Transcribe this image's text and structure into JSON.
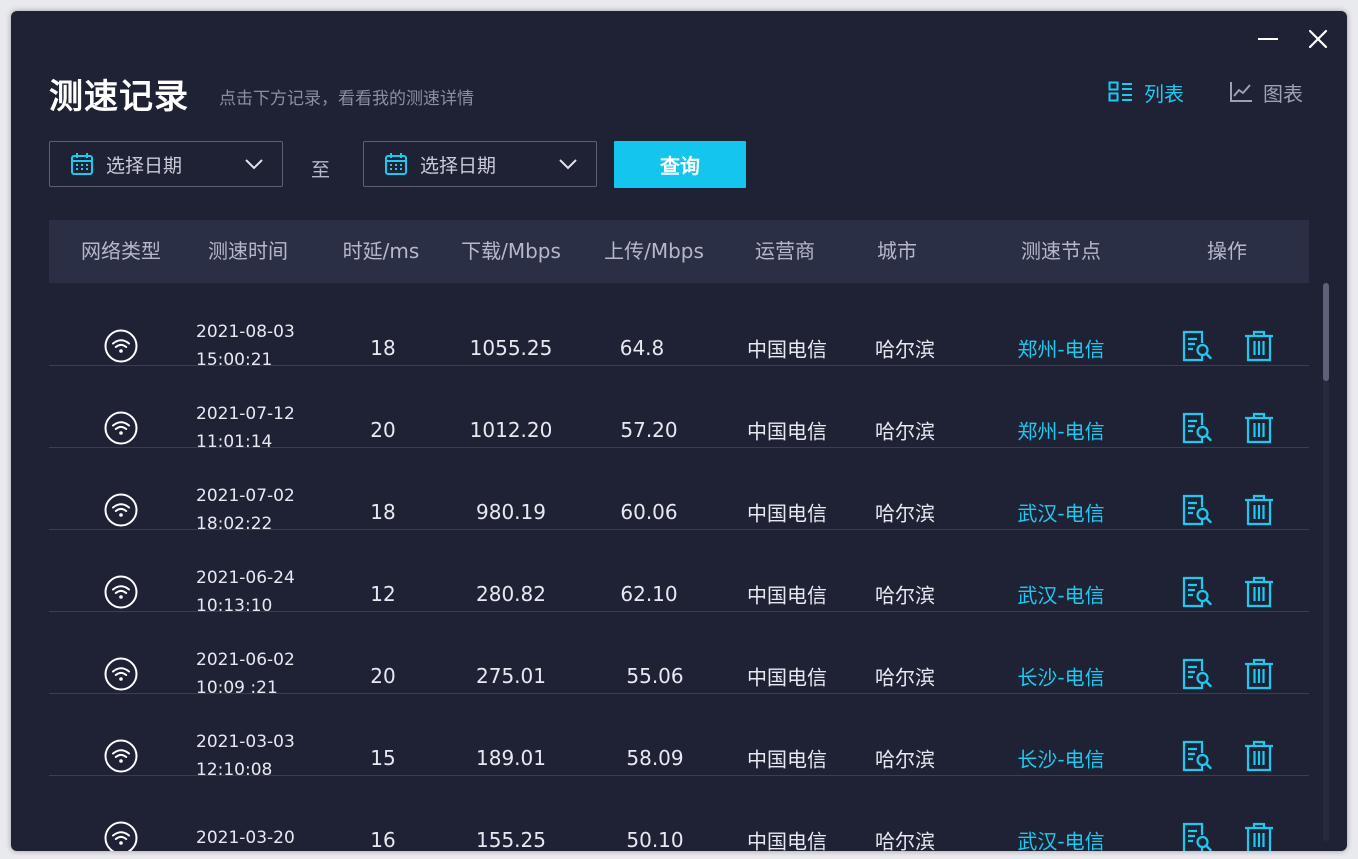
{
  "header": {
    "title": "测速记录",
    "subtitle": "点击下方记录，看看我的测速详情",
    "view_list_label": "列表",
    "view_chart_label": "图表"
  },
  "filters": {
    "date_from_placeholder": "选择日期",
    "separator": "至",
    "date_to_placeholder": "选择日期",
    "query_label": "查询"
  },
  "table": {
    "columns": [
      "网络类型",
      "测速时间",
      "时延/ms",
      "下载/Mbps",
      "上传/Mbps",
      "运营商",
      "城市",
      "测速节点",
      "操作"
    ],
    "rows": [
      {
        "date": "2021-08-03",
        "time": "15:00:21",
        "latency": "18",
        "download": "1055.25",
        "upload": "64.8",
        "isp": "中国电信",
        "city": "哈尔滨",
        "node": "郑州-电信"
      },
      {
        "date": "2021-07-12",
        "time": "11:01:14",
        "latency": "20",
        "download": "1012.20",
        "upload": "57.20",
        "isp": "中国电信",
        "city": "哈尔滨",
        "node": "郑州-电信"
      },
      {
        "date": "2021-07-02",
        "time": "18:02:22",
        "latency": "18",
        "download": "980.19",
        "upload": "60.06",
        "isp": "中国电信",
        "city": "哈尔滨",
        "node": "武汉-电信"
      },
      {
        "date": "2021-06-24",
        "time": "10:13:10",
        "latency": "12",
        "download": "280.82",
        "upload": "62.10",
        "isp": "中国电信",
        "city": "哈尔滨",
        "node": "武汉-电信"
      },
      {
        "date": "2021-06-02",
        "time": "10:09 :21",
        "latency": "20",
        "download": "275.01",
        "upload": "55.06",
        "isp": "中国电信",
        "city": "哈尔滨",
        "node": "长沙-电信"
      },
      {
        "date": "2021-03-03",
        "time": "12:10:08",
        "latency": "15",
        "download": "189.01",
        "upload": "58.09",
        "isp": "中国电信",
        "city": "哈尔滨",
        "node": "长沙-电信"
      },
      {
        "date": "2021-03-20",
        "time": "",
        "latency": "16",
        "download": "155.25",
        "upload": "50.10",
        "isp": "中国电信",
        "city": "哈尔滨",
        "node": "武汉-电信"
      }
    ]
  },
  "colors": {
    "background": "#1f2235",
    "header_row": "#2b2f46",
    "accent": "#14c6ee",
    "text": "#e7e9f1",
    "muted": "#8a8ea5"
  },
  "icons": {
    "network": "wifi-icon",
    "detail": "report-search-icon",
    "delete": "trash-icon",
    "calendar": "calendar-icon",
    "list": "list-view-icon",
    "chart": "line-chart-icon"
  }
}
